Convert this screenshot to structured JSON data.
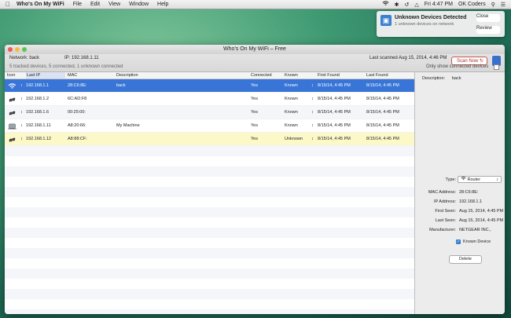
{
  "menubar": {
    "app_name": "Who's On My WiFi",
    "items": [
      "File",
      "Edit",
      "View",
      "Window",
      "Help"
    ],
    "clock": "Fri 4:47 PM",
    "user": "OK Coders"
  },
  "notification": {
    "title": "Unknown Devices Detected",
    "subtitle": "1 unknown devices on network",
    "close_label": "Close",
    "review_label": "Review"
  },
  "window": {
    "title": "Who's On My WiFi – Free",
    "network_label": "Network: back",
    "ip_label": "IP: 192.168.1.11",
    "last_scanned": "Last scanned Aug 15, 2014, 4:46 PM",
    "scan_label": "Scan Now",
    "summary": "5 tracked devices, 5 connected, 1 unknown connected",
    "only_connected_label": "Only show connected devices"
  },
  "table": {
    "headers": [
      "Icon",
      "Last IP",
      "MAC",
      "Description",
      "Connected",
      "Known",
      "First Found",
      "Last Found"
    ],
    "rows": [
      {
        "icon": "wifi-router-icon",
        "ip": "192.168.1.1",
        "mac": "28:C6:8E:",
        "description": "back",
        "connected": "Yes",
        "known": "Known",
        "first": "8/15/14, 4:45 PM",
        "last": "8/15/14, 4:45 PM"
      },
      {
        "icon": "link-icon",
        "ip": "192.168.1.2",
        "mac": "6C:AD:F8",
        "description": "",
        "connected": "Yes",
        "known": "Known",
        "first": "8/15/14, 4:45 PM",
        "last": "8/15/14, 4:45 PM"
      },
      {
        "icon": "link-icon",
        "ip": "192.168.1.6",
        "mac": "00:25:00:",
        "description": "",
        "connected": "Yes",
        "known": "Known",
        "first": "8/15/14, 4:45 PM",
        "last": "8/15/14, 4:45 PM"
      },
      {
        "icon": "laptop-icon",
        "ip": "192.168.1.11",
        "mac": "A8:20:66:",
        "description": "My Machine",
        "connected": "Yes",
        "known": "Known",
        "first": "8/15/14, 4:45 PM",
        "last": "8/15/14, 4:45 PM"
      },
      {
        "icon": "link-icon",
        "ip": "192.168.1.12",
        "mac": "A8:88:CF:",
        "description": "",
        "connected": "Yes",
        "known": "Unknown",
        "first": "8/15/14, 4:45 PM",
        "last": "8/15/14, 4:45 PM"
      }
    ]
  },
  "detail": {
    "description_label": "Description:",
    "description_value": "back",
    "type_label": "Type:",
    "type_value": "Router",
    "mac_label": "MAC Address:",
    "mac_value": "28:C6:8E:",
    "ip_label": "IP Address:",
    "ip_value": "192.168.1.1",
    "first_seen_label": "First Seen:",
    "first_seen_value": "Aug 15, 2014, 4:45 PM",
    "last_seen_label": "Last Seen:",
    "last_seen_value": "Aug 15, 2014, 4:45 PM",
    "manufacturer_label": "Manufacturer:",
    "manufacturer_value": "NETGEAR INC.,",
    "known_device_label": "Known Device",
    "delete_label": "Delete"
  },
  "colors": {
    "selection": "#3875d7",
    "unknown_row": "#fdf8c8",
    "scan_button": "#c25a4e"
  }
}
